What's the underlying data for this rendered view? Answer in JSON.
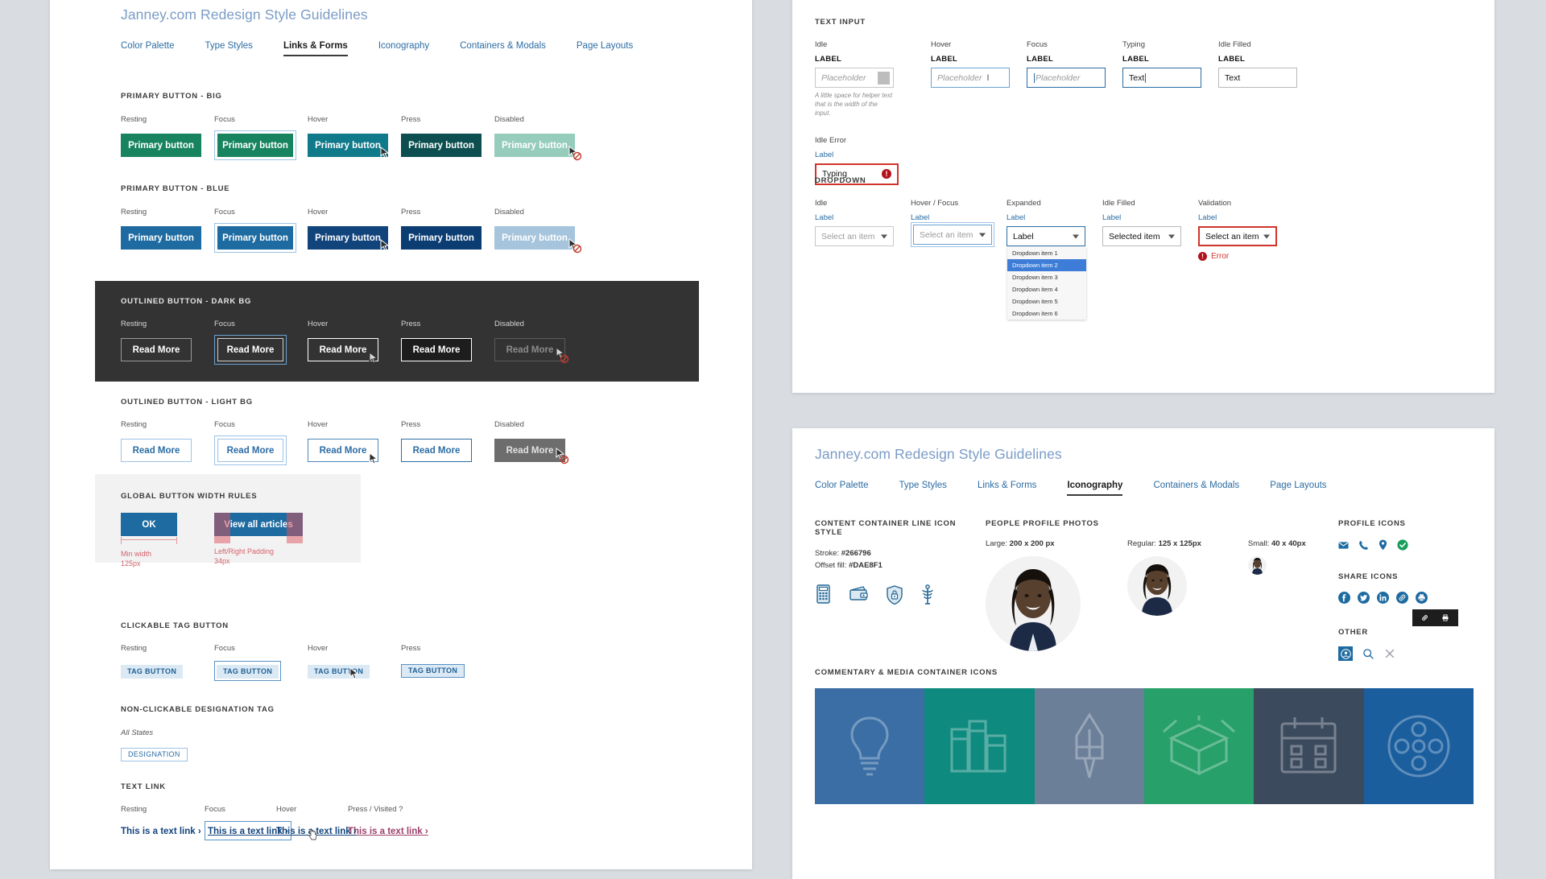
{
  "left_panel": {
    "doc_title": "Janney.com Redesign Style Guidelines",
    "tabs": [
      {
        "label": "Color Palette",
        "active": false
      },
      {
        "label": "Type Styles",
        "active": false
      },
      {
        "label": "Links & Forms",
        "active": true
      },
      {
        "label": "Iconography",
        "active": false
      },
      {
        "label": "Containers & Modals",
        "active": false
      },
      {
        "label": "Page Layouts",
        "active": false
      }
    ],
    "states": [
      "Resting",
      "Focus",
      "Hover",
      "Press",
      "Disabled"
    ],
    "primary_big": {
      "heading": "PRIMARY BUTTON - BIG",
      "label": "Primary button",
      "colors": {
        "resting": "#17845f",
        "focus": "#17845f",
        "hover": "#10798a",
        "press": "#0d4f50",
        "disabled": "#95ccbb"
      }
    },
    "primary_blue": {
      "heading": "PRIMARY BUTTON - BLUE",
      "label": "Primary button",
      "colors": {
        "resting": "#1e6ba1",
        "focus": "#1e6ba1",
        "hover": "#12447c",
        "press": "#0b3d72",
        "disabled": "#a6c4db"
      }
    },
    "outlined_dark": {
      "heading": "OUTLINED BUTTON - DARK BG",
      "label": "Read More",
      "bg": "#333333"
    },
    "outlined_light": {
      "heading": "OUTLINED BUTTON - LIGHT BG",
      "label": "Read More"
    },
    "global_width": {
      "heading": "GLOBAL BUTTON WIDTH RULES",
      "ok_label": "OK",
      "view_all_label": "View all articles",
      "min_width_title": "Min width",
      "min_width_value": "125px",
      "padding_title": "Left/Right Padding",
      "padding_value": "34px"
    },
    "clickable_tag": {
      "heading": "CLICKABLE TAG BUTTON",
      "label": "TAG BUTTON",
      "states": [
        "Resting",
        "Focus",
        "Hover",
        "Press"
      ]
    },
    "designation_tag": {
      "heading": "NON-CLICKABLE DESIGNATION TAG",
      "state": "All States",
      "label": "DESIGNATION"
    },
    "text_link": {
      "heading": "TEXT LINK",
      "states": [
        "Resting",
        "Focus",
        "Hover",
        "Press / Visited ?"
      ],
      "label": "This is a text link",
      "arrow": "›"
    }
  },
  "top_right_panel": {
    "text_input": {
      "heading": "TEXT INPUT",
      "states": [
        "Idle",
        "Hover",
        "Focus",
        "Typing",
        "Idle Filled"
      ],
      "label": "LABEL",
      "placeholder": "Placeholder",
      "typed_value": "Text",
      "filled_value": "Text",
      "helper_text": "A little space for helper text that is the width of the input.",
      "error_state": "Idle Error",
      "error_label": "Label",
      "error_value": "Typing"
    },
    "dropdown": {
      "heading": "DROPDOWN",
      "states": [
        "Idle",
        "Hover / Focus",
        "Expanded",
        "Idle Filled",
        "Validation"
      ],
      "label": "Label",
      "placeholder": "Select an item",
      "expanded_value": "Label",
      "filled_value": "Selected item",
      "validation_value": "Select an item",
      "error_text": "Error",
      "items": [
        "Dropdown item 1",
        "Dropdown item 2",
        "Dropdown item 3",
        "Dropdown item 4",
        "Dropdown item 5",
        "Dropdown item 6"
      ],
      "selected_index": 1
    }
  },
  "bottom_right_panel": {
    "doc_title": "Janney.com Redesign Style Guidelines",
    "tabs": [
      {
        "label": "Color Palette",
        "active": false
      },
      {
        "label": "Type Styles",
        "active": false
      },
      {
        "label": "Links & Forms",
        "active": false
      },
      {
        "label": "Iconography",
        "active": true
      },
      {
        "label": "Containers & Modals",
        "active": false
      },
      {
        "label": "Page Layouts",
        "active": false
      }
    ],
    "line_icons": {
      "heading": "CONTENT CONTAINER LINE ICON STYLE",
      "stroke_label": "Stroke:",
      "stroke_value": "#266796",
      "offset_label": "Offset fill:",
      "offset_value": "#DAE8F1",
      "icons": [
        "calculator-icon",
        "wallet-icon",
        "shield-lock-icon",
        "caduceus-icon"
      ]
    },
    "profile_photos": {
      "heading": "PEOPLE PROFILE PHOTOS",
      "sizes": [
        {
          "name": "Large:",
          "value": "200 x 200 px"
        },
        {
          "name": "Regular:",
          "value": "125 x 125px"
        },
        {
          "name": "Small:",
          "value": "40 x 40px"
        }
      ]
    },
    "profile_icons": {
      "heading": "PROFILE ICONS",
      "icons": [
        "email-icon",
        "phone-icon",
        "location-pin-icon",
        "verified-check-icon"
      ],
      "accent": "#1e6ba1",
      "verified_color": "#1a9e5c"
    },
    "share_icons": {
      "heading": "SHARE ICONS",
      "icons": [
        "facebook-icon",
        "twitter-icon",
        "linkedin-icon",
        "link-icon",
        "print-icon"
      ],
      "tooltip_icons": [
        "link-icon",
        "print-icon"
      ]
    },
    "other_icons": {
      "heading": "OTHER",
      "icons": [
        "account-icon",
        "search-icon",
        "close-icon"
      ]
    },
    "media_icons": {
      "heading": "COMMENTARY & MEDIA CONTAINER ICONS",
      "cells": [
        {
          "icon": "lightbulb-icon",
          "color": "#3a6ea5"
        },
        {
          "icon": "books-icon",
          "color": "#0f8a7e"
        },
        {
          "icon": "pen-nib-icon",
          "color": "#6b7f99"
        },
        {
          "icon": "open-box-icon",
          "color": "#28a06a"
        },
        {
          "icon": "calendar-icon",
          "color": "#3c4a5e"
        },
        {
          "icon": "film-reel-icon",
          "color": "#1b5e9e"
        }
      ]
    }
  }
}
